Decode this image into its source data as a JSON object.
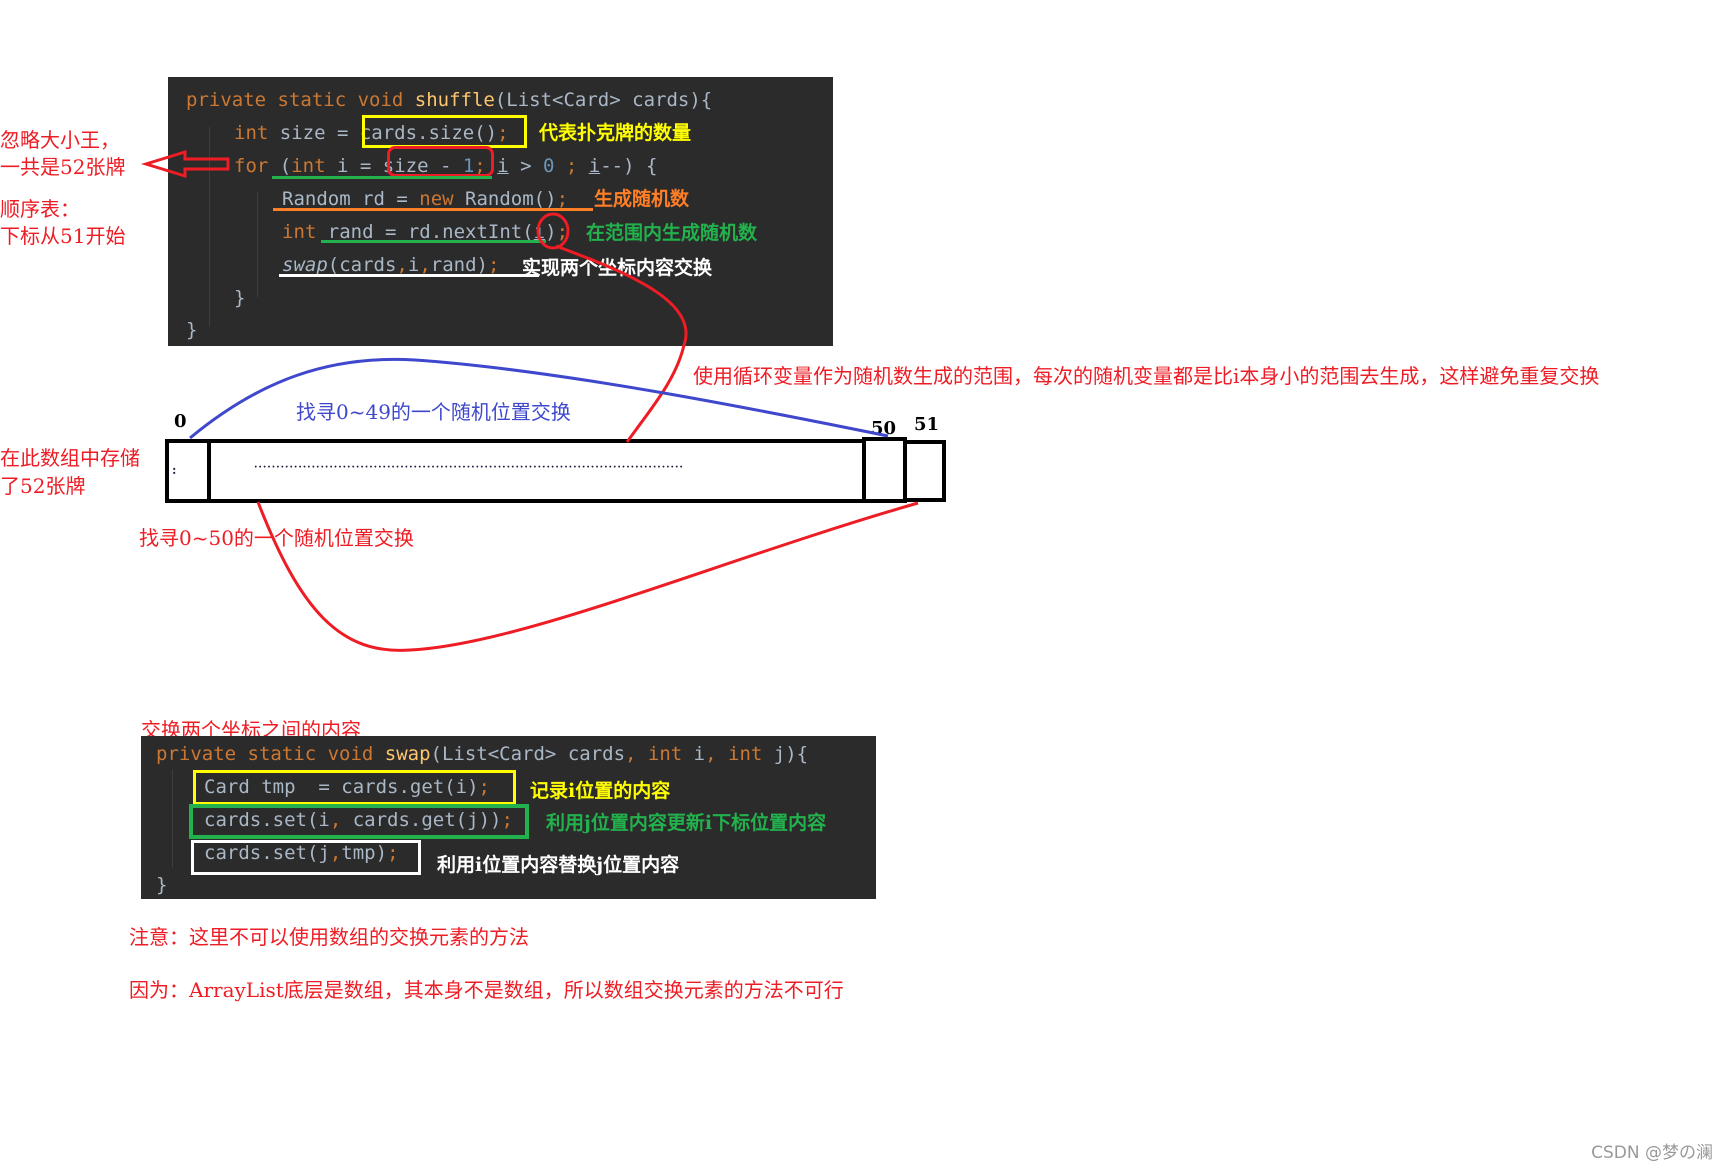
{
  "shuffle_code": {
    "line1": {
      "kw": "private static void ",
      "fn": "shuffle",
      "rest": "(List<Card> cards){"
    },
    "line2": {
      "kw": "int ",
      "pre": "size = ",
      "boxed": "cards.size()",
      "semi": ";"
    },
    "line3": {
      "kw": "for ",
      "p1": "(",
      "kw2": "int",
      "p2": " i = ",
      "boxed": "size - ",
      "num": "1",
      "p3": "; ",
      "i1": "i",
      "p4": " > ",
      "zero": "0",
      "p5": " ; ",
      "i2": "i",
      "p6": "--) {"
    },
    "line4": {
      "pre": "Random rd = ",
      "kw": "new",
      "post": " Random()",
      "semi": ";"
    },
    "line5": {
      "kw": "int ",
      "pre": "rand = rd.nextInt(",
      "arg": "i",
      "post": ")",
      "semi": ";"
    },
    "line6": {
      "fn": "swap",
      "rest": "(cards",
      "c1": ",",
      "i": "i",
      "c2": ",",
      "rest2": "rand)",
      "semi": ";"
    },
    "close_inner": "}",
    "close_outer": "}"
  },
  "swap_code": {
    "title": "交换两个坐标之间的内容",
    "line1": {
      "kw": "private static void ",
      "fn": "swap",
      "p1": "(List<Card> cards",
      "c1": ", ",
      "kw2": "int",
      "p2": " i",
      "c2": ", ",
      "kw3": "int",
      "p3": " j){"
    },
    "line2": {
      "text": "Card tmp  = cards.get(i)",
      "semi": ";"
    },
    "line3": {
      "text": "cards.set(i",
      "c": ",",
      "text2": " cards.get(j))",
      "semi": ";"
    },
    "line4": {
      "text": "cards.set(j",
      "c": ",",
      "text2": "tmp)",
      "semi": ";"
    },
    "close": "}"
  },
  "annotations": {
    "size_meaning": "代表扑克牌的数量",
    "gen_random": "生成随机数",
    "gen_in_range": "在范围内生成随机数",
    "swap_contents": "实现两个坐标内容交换",
    "left_note_1": "忽略大小王，",
    "left_note_2": "一共是52张牌",
    "left_note_3": "顺序表：",
    "left_note_4": "下标从51开始",
    "range_explain": "使用循环变量作为随机数生成的范围，每次的随机变量都是比i本身小的范围去生成，这样避免重复交换",
    "array_note_1": "在此数组中存储",
    "array_note_2": "了52张牌",
    "blue_arc_label": "找寻0~49的一个随机位置交换",
    "red_arc_label": "找寻0~50的一个随机位置交换",
    "record_i": "记录i位置的内容",
    "update_i": "利用j位置内容更新i下标位置内容",
    "replace_j": "利用i位置内容替换j位置内容",
    "warning": "注意：这里不可以使用数组的交换元素的方法",
    "reason": "因为：ArrayList底层是数组，其本身不是数组，所以数组交换元素的方法不可行"
  },
  "array": {
    "index_first": "0",
    "index_50": "50",
    "index_51": "51",
    "ellipsis": "·································································································",
    "cell0_marks": ":"
  },
  "watermark": "CSDN @梦の澜",
  "colors": {
    "code_bg": "#2b2b2b",
    "keyword": "#cc7832",
    "function": "#ffc66d",
    "number": "#6897bb",
    "text": "#a9b7c6",
    "red": "#ee1c24",
    "blue": "#3f48cc",
    "yellow": "#ffff00",
    "green": "#22b14c",
    "orange": "#ff7f27"
  }
}
